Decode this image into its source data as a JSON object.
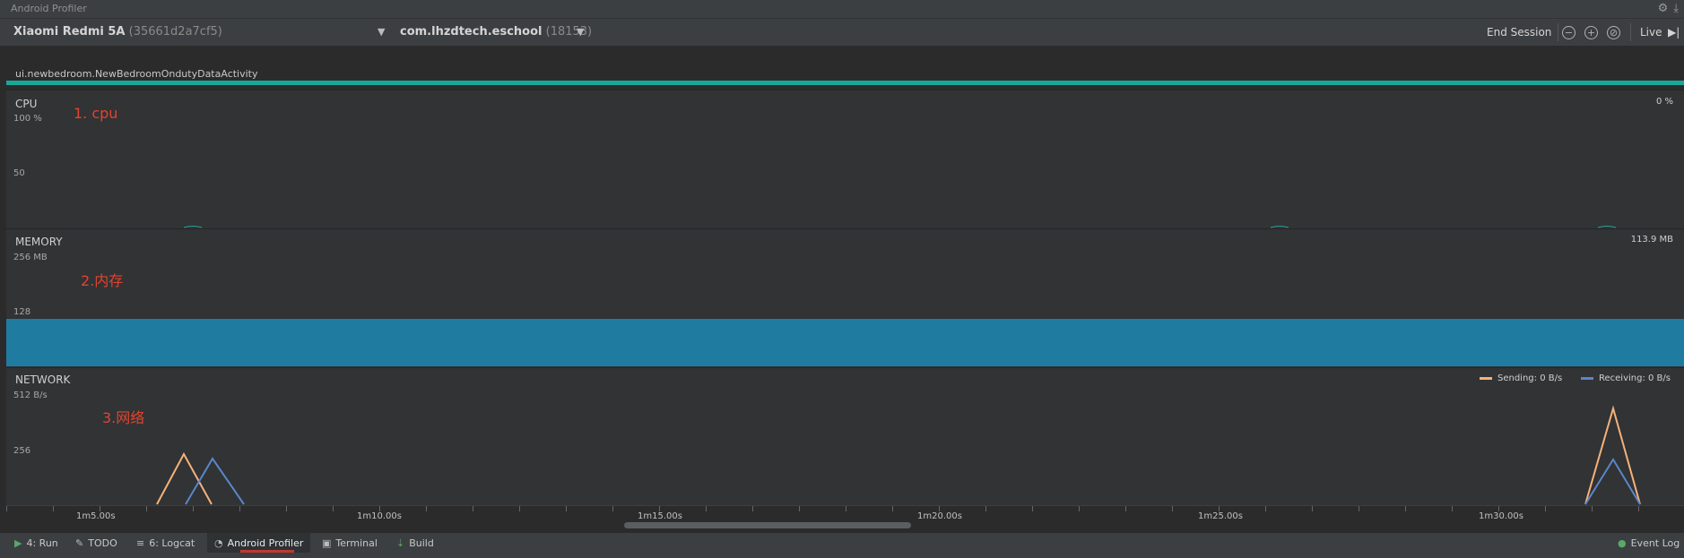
{
  "window": {
    "title": "Android Profiler"
  },
  "toolbar": {
    "device_name": "Xiaomi Redmi 5A",
    "device_serial": "(35661d2a7cf5)",
    "process_name": "com.lhzdtech.eschool",
    "process_pid": "(18153)",
    "end_session_label": "End Session",
    "live_label": "Live"
  },
  "activity": {
    "label": "ui.newbedroom.NewBedroomOndutyDataActivity"
  },
  "cpu": {
    "title": "CPU",
    "tick_top": "100 %",
    "tick_mid": "50",
    "value": "0 %",
    "annotation": "1. cpu"
  },
  "memory": {
    "title": "MEMORY",
    "tick_top": "256 MB",
    "tick_mid": "128",
    "value": "113.9 MB",
    "annotation": "2.内存"
  },
  "network": {
    "title": "NETWORK",
    "tick_top": "512 B/s",
    "tick_mid": "256",
    "annotation": "3.网络",
    "legend_sending": "Sending: 0 B/s",
    "legend_receiving": "Receiving: 0 B/s",
    "sending_color": "#f5b27a",
    "receiving_color": "#5b86c9"
  },
  "timeline": {
    "labels": [
      "1m5.00s",
      "1m10.00s",
      "1m15.00s",
      "1m20.00s",
      "1m25.00s",
      "1m30.00s"
    ]
  },
  "bottom_tabs": [
    {
      "label": "4: Run",
      "icon": "run-icon"
    },
    {
      "label": "TODO",
      "icon": "todo-icon"
    },
    {
      "label": "6: Logcat",
      "icon": "logcat-icon"
    },
    {
      "label": "Android Profiler",
      "icon": "profiler-icon"
    },
    {
      "label": "Terminal",
      "icon": "terminal-icon"
    },
    {
      "label": "Build",
      "icon": "build-icon"
    }
  ],
  "event_log_label": "Event Log"
}
